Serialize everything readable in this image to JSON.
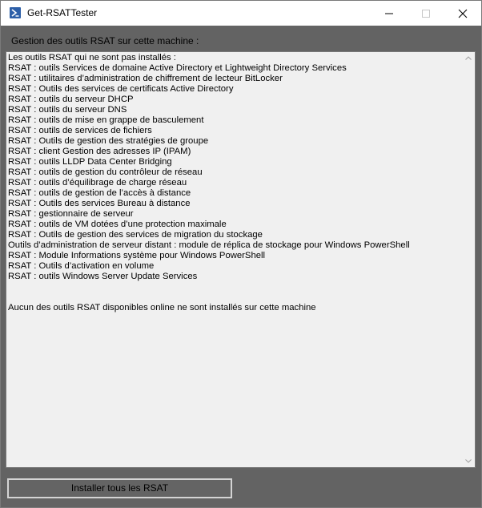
{
  "window": {
    "title": "Get-RSATTester",
    "icon": "powershell-icon",
    "controls": [
      "minimize-icon",
      "maximize-icon",
      "close-icon"
    ]
  },
  "group": {
    "label": "Gestion des outils RSAT sur cette machine :"
  },
  "output_lines": [
    "Les outils RSAT qui ne sont pas installés :",
    "RSAT : outils Services de domaine Active Directory et Lightweight Directory Services",
    "RSAT : utilitaires d’administration de chiffrement de lecteur BitLocker",
    "RSAT : Outils des services de certificats Active Directory",
    "RSAT : outils du serveur DHCP",
    "RSAT : outils du serveur DNS",
    "RSAT : outils de mise en grappe de basculement",
    "RSAT : outils de services de fichiers",
    "RSAT : Outils de gestion des stratégies de groupe",
    "RSAT : client Gestion des adresses IP (IPAM)",
    "RSAT : outils LLDP Data Center Bridging",
    "RSAT : outils de gestion du contrôleur de réseau",
    "RSAT : outils d’équilibrage de charge réseau",
    "RSAT : outils de gestion de l’accès à distance",
    "RSAT : Outils des services Bureau à distance",
    "RSAT : gestionnaire de serveur",
    "RSAT : outils de VM dotées d’une protection maximale",
    "RSAT : Outils de gestion des services de migration du stockage",
    "Outils d’administration de serveur distant : module de réplica de stockage pour Windows PowerShell",
    "RSAT : Module Informations système pour Windows PowerShell",
    "RSAT : Outils d’activation en volume",
    "RSAT : outils Windows Server Update Services",
    "",
    "",
    "Aucun des outils RSAT disponibles online ne sont installés sur cette machine"
  ],
  "buttons": {
    "install_all": "Installer tous les RSAT"
  },
  "colors": {
    "client_background": "#636363",
    "textbox_background": "#f0f0f0",
    "powershell_blue": "#2d5fa8"
  }
}
